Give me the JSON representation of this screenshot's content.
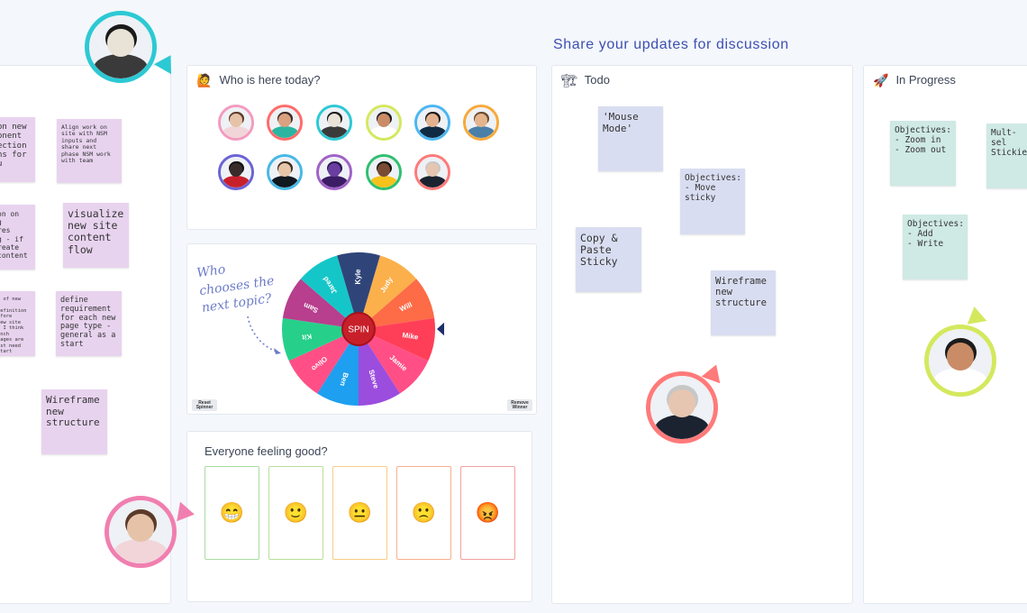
{
  "header": {
    "title": "Share your updates for discussion"
  },
  "attendance": {
    "title": "Who is here today?",
    "icon": "person-icon",
    "avatars": [
      {
        "ring": "#f39bc0",
        "skin": "#e6c3a8",
        "hair": "#5b3a2a",
        "shirt": "#f2d5d9"
      },
      {
        "ring": "#ff6b6b",
        "skin": "#d9a17f",
        "hair": "#3a2a25",
        "shirt": "#2bb5a0"
      },
      {
        "ring": "#2cc9d4",
        "skin": "#e9e2d6",
        "hair": "#1a1a1a",
        "shirt": "#3a3a3a"
      },
      {
        "ring": "#d4e85e",
        "skin": "#c98c66",
        "hair": "#1b1b1b",
        "shirt": "#ffffff"
      },
      {
        "ring": "#4cb6f0",
        "skin": "#e2b18f",
        "hair": "#1b1b1b",
        "shirt": "#0f2a44"
      },
      {
        "ring": "#f7a93b",
        "skin": "#e4b48d",
        "hair": "#6b4a2d",
        "shirt": "#4a7fa8"
      },
      {
        "ring": "#6b63d6",
        "skin": "#3a2b2b",
        "hair": "#111111",
        "shirt": "#c8202a"
      },
      {
        "ring": "#47b8e6",
        "skin": "#e6c5a8",
        "hair": "#3a2a20",
        "shirt": "#101820"
      },
      {
        "ring": "#a062c7",
        "skin": "#6a3ea0",
        "hair": "#2a1550",
        "shirt": "#3b1d66"
      },
      {
        "ring": "#2fbf71",
        "skin": "#7a4a32",
        "hair": "#111111",
        "shirt": "#f6c21b"
      },
      {
        "ring": "#ff7a7a",
        "skin": "#e6c6b0",
        "hair": "#c7c7c7",
        "shirt": "#1c2330"
      }
    ]
  },
  "spinner": {
    "note": "Who chooses the next topic?",
    "center_label": "SPIN",
    "names": [
      "Kyle",
      "Judy",
      "Will",
      "Mike",
      "Jamie",
      "Steve",
      "Ben",
      "Olivo",
      "Kit",
      "Sam",
      "Jared"
    ],
    "colors": [
      "#2f4579",
      "#fbb04b",
      "#fd6b47",
      "#ff3f57",
      "#ff4f86",
      "#9b4dde",
      "#1e9ff0",
      "#ff4f86",
      "#26d08a",
      "#b73f8d",
      "#15c6c8"
    ],
    "reset_label": "Reset Spinner",
    "remove_label": "Remove Winner"
  },
  "feeling": {
    "title": "Everyone feeling good?",
    "moods": [
      {
        "face": "😁",
        "color": "#69c361",
        "border": "#a9dda3"
      },
      {
        "face": "🙂",
        "color": "#7bc33d",
        "border": "#b9df98"
      },
      {
        "face": "😐",
        "color": "#f3a21b",
        "border": "#f7cd86"
      },
      {
        "face": "🙁",
        "color": "#f56a31",
        "border": "#f8b08f"
      },
      {
        "face": "😡",
        "color": "#ee4141",
        "border": "#f4a0a0"
      }
    ]
  },
  "columns": {
    "todo": {
      "title": "Todo",
      "icon": "crane-icon"
    },
    "in_progress": {
      "title": "In Progress",
      "icon": "rocket-icon"
    }
  },
  "left_stickies": [
    "on new\nonent\nection\nns for\nu",
    "Align work on site with NSM inputs and share next phase NSM work with team",
    "on on\ng\nres\ng - if\nreate\ncontent",
    "visualize new site content flow",
    "y of new\nt definition\nefore\nnew site\n- I think\nunch\npages are\nust need\nstart",
    "define requirement for each new page type - general as a start",
    "Wireframe new structure"
  ],
  "todo_stickies": [
    "'Mouse Mode'",
    "Objectives:\n- Move sticky",
    "Copy & Paste Sticky",
    "Wireframe new structure"
  ],
  "progress_stickies": [
    "Objectives:\n- Zoom in\n- Zoom out",
    "Mult-sel\nStickies",
    "Objectives:\n- Add\n- Write"
  ],
  "cursors": [
    {
      "name": "puppy-cursor",
      "ring": "#2cc9d4",
      "skin": "#e9e2d6",
      "hair": "#1a1a1a",
      "shirt": "#3a3a3a"
    },
    {
      "name": "woman-cursor",
      "ring": "#f07fb0",
      "skin": "#e6c3a8",
      "hair": "#5b3a2a",
      "shirt": "#f2d5d9"
    },
    {
      "name": "man-glasses-cursor",
      "ring": "#ff7a7a",
      "skin": "#e6c6b0",
      "hair": "#c7c7c7",
      "shirt": "#1c2330"
    },
    {
      "name": "man-cursor",
      "ring": "#d4e85e",
      "skin": "#c98c66",
      "hair": "#1b1b1b",
      "shirt": "#ffffff"
    }
  ]
}
